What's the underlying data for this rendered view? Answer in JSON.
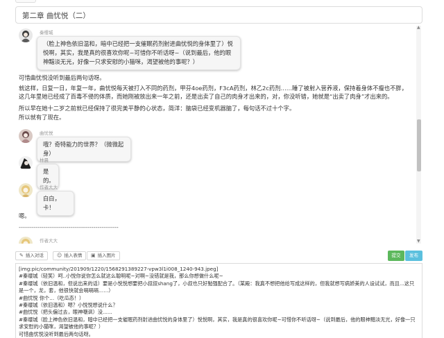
{
  "chapter_title": "第二章 曲忧悦（二）",
  "messages": [
    {
      "name": "秦缨城",
      "text": "（脸上神色依旧温和，暗中已经把一支催眠药剂射进曲忧悦的身体里了）悦悦啊，其实，我是真的很喜欢你呢~可惜你不听话呀~（说到最后，他的眼神黯淡无光，好像一只求安慰的小猫咪，渴望被他的事呢？）"
    },
    {
      "name": "曲忧悦",
      "text": "哦？奇特能力的世界？（微微起身）"
    },
    {
      "name": "林晨",
      "text": "是的。"
    },
    {
      "name": "作者大大",
      "text": "白白，卡！"
    },
    {
      "name": "作者大大",
      "text": ""
    }
  ],
  "narration": {
    "p1": "可惜曲忧悦没听到最后两句话呀。",
    "p2": "就这样，日复一日，年复一年，曲忧悦每天被打入不同的药剂，甲芬4oe药剂，F3cA药剂，林乙2c药剂……睡了被射入营养液，保持着身体不瘦也不胖，这几年里她已经成了百毒不侵的体质，而她刚被放出来一年之前，还是出卖了自己的肉身才出来的，对，你没听错，她就是“出卖了肉身”才出来的。",
    "p3": "所以早在她十二岁之前就已经保持了很完美平静的心状态，简洋：脑袋已经变机器脑了，每句话不过十个字。",
    "p4": "所以就有了现在。",
    "p5": "嗯。",
    "divider": "------------------------------------------------"
  },
  "toolbar": {
    "insert_dialog": "插入对话",
    "insert_emoji": "插入表情",
    "insert_image": "插入图片",
    "submit": "提交",
    "publish": "发布"
  },
  "editor_lines": [
    "[img:pic/community/201909/1220/1568291389227-vpw3l1i008_1240-943.jpeg]",
    "#秦缨城（轻笑）呵..小悦你说你怎么就这么聪明呢~对啊~没错就是我，那么你想做什么呢~",
    "#秦缨城（依旧温和，但说出来的话）要是小悦悦想要把小叔叔shang了，小叔也只好勉强配合了。（某殿：我真不想把他给写成这样的，但我就想写病娇美的人设试试，而且...这只是一个，龙，套，他很快就会嗝嗝嗝……）",
    "#曲忧悦 你个...（吃瓜态！）",
    "#秦缨城（依旧温和）嗯？小悦悦想说什么？",
    "#曲忧悦（把头偏过去，眼神嘲讽）没......",
    "#秦缨城（脸上神色依旧温和，暗中已经把一支催眠药剂射进曲忧悦的身体里了）悦悦啊，其实，我是真的很喜欢你呢~可惜你不听话呀~（说到最后，他的眼神黯淡无光，好像一只求安慰的小猫咪，渴望被他的事呢？）",
    "可惜曲忧悦没听到最后两句话呀。"
  ],
  "icons": {
    "dialog": "chat-icon",
    "emoji": "emoji-icon",
    "image": "image-icon"
  },
  "colors": {
    "submit": "#5cb85c",
    "publish": "#5bc0de"
  }
}
